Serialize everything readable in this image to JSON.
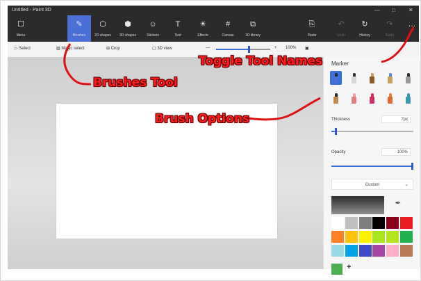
{
  "window": {
    "title": "Untitled - Paint 3D"
  },
  "ribbon": {
    "items": [
      {
        "label": "Menu",
        "icon": "folder-icon",
        "glyph": "☐",
        "active": false
      },
      {
        "label": "Brushes",
        "icon": "brush-icon",
        "glyph": "✎",
        "active": true
      },
      {
        "label": "2D shapes",
        "icon": "2d-shapes-icon",
        "glyph": "⬡",
        "active": false
      },
      {
        "label": "3D shapes",
        "icon": "3d-shapes-icon",
        "glyph": "⬢",
        "active": false
      },
      {
        "label": "Stickers",
        "icon": "stickers-icon",
        "glyph": "☺",
        "active": false
      },
      {
        "label": "Text",
        "icon": "text-icon",
        "glyph": "T",
        "active": false
      },
      {
        "label": "Effects",
        "icon": "effects-icon",
        "glyph": "☀",
        "active": false
      },
      {
        "label": "Canvas",
        "icon": "canvas-icon",
        "glyph": "#",
        "active": false
      },
      {
        "label": "3D library",
        "icon": "3d-library-icon",
        "glyph": "⧉",
        "active": false
      }
    ],
    "right_items": [
      {
        "label": "Paste",
        "icon": "paste-icon",
        "glyph": "⎘",
        "dim": false
      },
      {
        "label": "Undo",
        "icon": "undo-icon",
        "glyph": "↶",
        "dim": true
      },
      {
        "label": "History",
        "icon": "history-icon",
        "glyph": "↻",
        "dim": false
      },
      {
        "label": "Redo",
        "icon": "redo-icon",
        "glyph": "↷",
        "dim": true
      },
      {
        "label": "",
        "icon": "more-icon",
        "glyph": "…",
        "dim": false
      }
    ]
  },
  "toolbar": {
    "select_label": "Select",
    "magic_select_label": "Magic select",
    "crop_label": "Crop",
    "view_label": "3D view",
    "zoom_value": "100%",
    "zoom_level": 0.6
  },
  "panel": {
    "title": "Marker",
    "brushes": [
      {
        "name": "marker",
        "tip": "#2a2a2a",
        "body": "#4a70d8",
        "selected": true
      },
      {
        "name": "calligraphy-pen",
        "tip": "#2a2a2a",
        "body": "#d9d9d9",
        "selected": false
      },
      {
        "name": "oil-brush",
        "tip": "#c8a060",
        "body": "#8a5a2a",
        "selected": false
      },
      {
        "name": "watercolor",
        "tip": "#5a8ad8",
        "body": "#c9a25a",
        "selected": false
      },
      {
        "name": "pixel-pen",
        "tip": "#2a2a2a",
        "body": "#9a9a9a",
        "selected": false
      },
      {
        "name": "pencil",
        "tip": "#2a2a2a",
        "body": "#c08a4a",
        "selected": false
      },
      {
        "name": "eraser",
        "tip": "#f0a0a0",
        "body": "#e08080",
        "selected": false
      },
      {
        "name": "crayon",
        "tip": "#d03060",
        "body": "#d03060",
        "selected": false
      },
      {
        "name": "spray-can",
        "tip": "#e08040",
        "body": "#e06a30",
        "selected": false
      },
      {
        "name": "fill",
        "tip": "#3a9ab0",
        "body": "#3a9ab0",
        "selected": false
      }
    ],
    "thickness_label": "Thickness",
    "thickness_value": "7px",
    "thickness_level": 0.05,
    "opacity_label": "Opacity",
    "opacity_value": "100%",
    "opacity_level": 1.0,
    "texture_label": "Custom",
    "palette": [
      "#ffffff",
      "#c0c0c0",
      "#7f7f7f",
      "#000000",
      "#88001b",
      "#ec1c24",
      "#ff7f27",
      "#ffc20e",
      "#fff200",
      "#a8e61d",
      "#b5e61d",
      "#22b14c",
      "#99d9ea",
      "#00a2e8",
      "#3f48cc",
      "#a349a4",
      "#ffaec9",
      "#b97a57"
    ]
  },
  "annotations": {
    "brushes_tool": "Brushes Tool",
    "brush_options": "Brush Options",
    "toggle_tool_names": "Toggle Tool Names"
  }
}
